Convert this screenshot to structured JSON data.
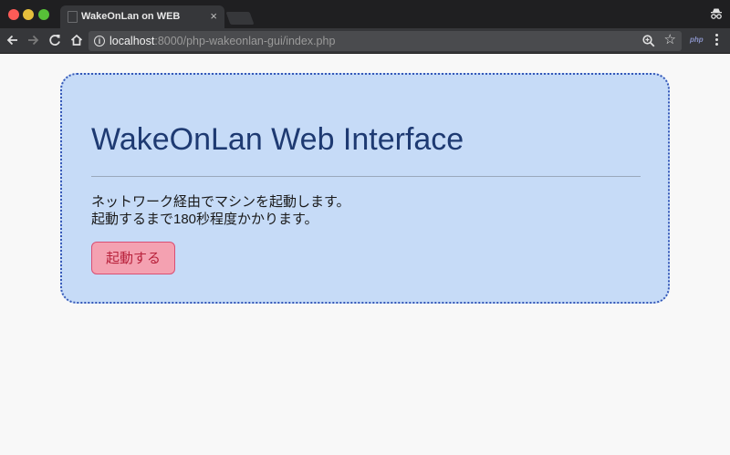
{
  "browser": {
    "tab_title": "WakeOnLan on WEB",
    "tab_close": "×",
    "url_host": "localhost",
    "url_path": ":8000/php-wakeonlan-gui/index.php",
    "extension_label": "php",
    "info_glyph": "i"
  },
  "page": {
    "heading": "WakeOnLan Web Interface",
    "description_line1": "ネットワーク経由でマシンを起動します。",
    "description_line2": "起動するまで180秒程度かかります。",
    "start_button": "起動する"
  },
  "colors": {
    "card_background": "#c6dbf7",
    "card_border": "#3558b8",
    "heading_color": "#1e3a72",
    "button_background": "#f4a1b1",
    "button_border": "#d94f74",
    "button_text": "#b8213b"
  },
  "icons": {
    "back": "back-arrow-icon",
    "forward": "forward-arrow-icon",
    "reload": "reload-icon",
    "home": "home-icon",
    "info": "info-icon",
    "zoom": "zoom-icon",
    "bookmark": "star-icon",
    "menu": "more-vert-icon",
    "profile": "incognito-icon"
  }
}
